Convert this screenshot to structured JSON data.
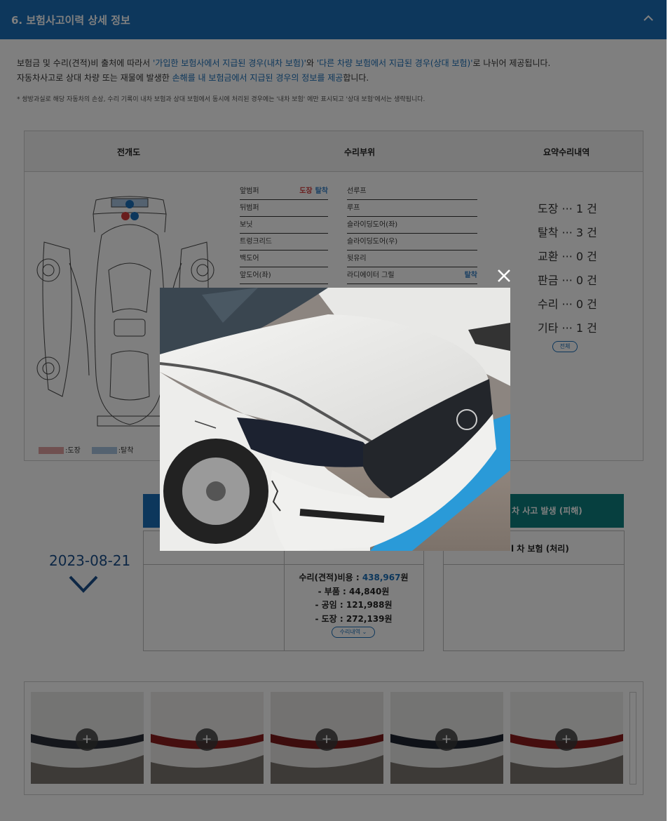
{
  "header": {
    "title": "6. 보험사고이력 상세 정보"
  },
  "description": {
    "line1_pre": "보험금 및 수리(견적)비 출처에 따라서 ",
    "line1_hl1": "'가입한 보험사에서 지급된 경우(내차 보험)'",
    "line1_mid": "와 ",
    "line1_hl2": "'다른 차량 보험에서 지급된 경우(상대 보험)'",
    "line1_post": "로 나뉘어 제공됩니다.",
    "line2_pre": "자동차사고로 상대 차량 또는 재물에 발생한 ",
    "line2_hl": "손해를 내 보험금에서 지급된 경우의 정보를 제공",
    "line2_post": "합니다.",
    "note": "* 쌍방과실로 해당 자동차의 손상, 수리 기록이 내차 보험과 상대 보험에서 동시에 처리된 경우에는 '내차 보험' 에만 표시되고 '상대 보험'에서는 생략됩니다."
  },
  "table": {
    "col1": "전개도",
    "col2": "수리부위",
    "col3": "요약수리내역"
  },
  "parts_left": [
    {
      "name": "앞범퍼",
      "tags": [
        "도장",
        "탈착"
      ]
    },
    {
      "name": "뒤범퍼",
      "tags": []
    },
    {
      "name": "보닛",
      "tags": []
    },
    {
      "name": "트렁크리드",
      "tags": []
    },
    {
      "name": "백도어",
      "tags": []
    },
    {
      "name": "앞도어(좌)",
      "tags": []
    }
  ],
  "parts_right": [
    {
      "name": "선루프",
      "tags": []
    },
    {
      "name": "루프",
      "tags": []
    },
    {
      "name": "슬라이딩도어(좌)",
      "tags": []
    },
    {
      "name": "슬라이딩도어(우)",
      "tags": []
    },
    {
      "name": "뒷유리",
      "tags": []
    },
    {
      "name": "라디에이터 그릴",
      "tags": [
        "탈착"
      ]
    }
  ],
  "summary": [
    "도장 ··· 1 건",
    "탈착 ··· 3 건",
    "교환 ··· 0 건",
    "판금 ··· 0 건",
    "수리 ··· 0 건",
    "기타 ··· 1 건"
  ],
  "summary_all_btn": "전체",
  "legend": {
    "paint": ":도장",
    "detach": ":탈착"
  },
  "accident": {
    "date": "2023-08-21",
    "green_header": "차 사고 발생 (피해)",
    "green_sub": "l 차 보험 (처리)",
    "cost_label": "수리(견적)비용 : ",
    "cost_value": "438,967",
    "cost_unit": "원",
    "parts": "- 부품 : 44,840원",
    "labor": "- 공임 : 121,988원",
    "paint": "- 도장 : 272,139원",
    "detail_btn": "수리내역 ⌄"
  },
  "thumbnails": [
    "+",
    "+",
    "+",
    "+",
    "+"
  ],
  "colors": {
    "header": "#1a6fb8",
    "green": "#0d7f7f",
    "paint": "#e0a0a0",
    "detach": "#a8c4e0"
  }
}
